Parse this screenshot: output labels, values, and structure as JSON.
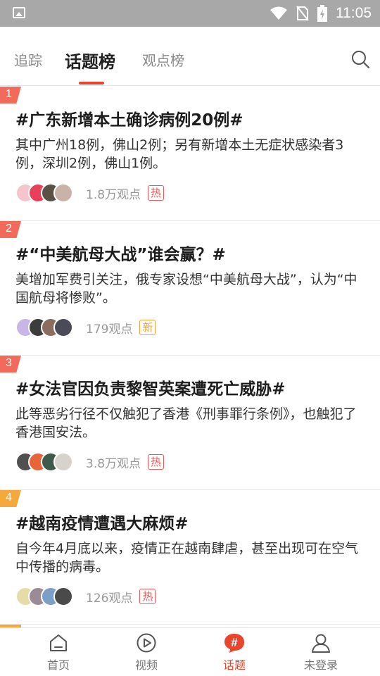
{
  "status_bar": {
    "time": "11:05"
  },
  "tabs": [
    {
      "label": "追踪"
    },
    {
      "label": "话题榜",
      "active": true
    },
    {
      "label": "观点榜"
    }
  ],
  "topics": [
    {
      "rank": "1",
      "rank_color": "#f26a5a",
      "title": "#广东新增本土确诊病例20例#",
      "desc": "其中广州18例，佛山2例；另有新增本土无症状感染者3例，深圳2例，佛山1例。",
      "views": "1.8万观点",
      "badge": "热",
      "avatar_colors": [
        "#f3c6cc",
        "#e8405a",
        "#5a5046",
        "#c9b3a8"
      ]
    },
    {
      "rank": "2",
      "rank_color": "#f26a5a",
      "title": "#“中美航母大战”谁会赢？#",
      "desc": "美增加军费引关注，俄专家设想“中美航母大战”，认为“中国航母将惨败”。",
      "views": "179观点",
      "badge": "新",
      "avatar_colors": [
        "#c8b6e6",
        "#3c3c3c",
        "#8a6d5e",
        "#4a4a58"
      ]
    },
    {
      "rank": "3",
      "rank_color": "#f26a5a",
      "title": "#女法官因负责黎智英案遭死亡威胁#",
      "desc": "此等恶劣行径不仅触犯了香港《刑事罪行条例》，也触犯了香港国安法。",
      "views": "3.8万观点",
      "badge": "热",
      "avatar_colors": [
        "#505050",
        "#e8653a",
        "#3f5a4a",
        "#d8d2cc"
      ]
    },
    {
      "rank": "4",
      "rank_color": "#f6a93b",
      "title": "#越南疫情遭遇大麻烦#",
      "desc": "自今年4月底以来，疫情正在越南肆虐，甚至出现可在空气中传播的病毒。",
      "views": "126观点",
      "badge": "热",
      "avatar_colors": [
        "#e6dcaa",
        "#9c8a96",
        "#7aa0c8",
        "#4a4a4a"
      ]
    }
  ],
  "bottom_nav": [
    {
      "label": "首页",
      "icon": "home-icon"
    },
    {
      "label": "视频",
      "icon": "play-circle-icon"
    },
    {
      "label": "话题",
      "icon": "hashtag-bubble-icon",
      "active": true
    },
    {
      "label": "未登录",
      "icon": "user-icon"
    }
  ],
  "colors": {
    "accent": "#e8452c",
    "hot": "#ef5a5a",
    "new": "#f5a23b",
    "rank_top": "#f26a5a",
    "rank_fourth": "#f6a93b"
  }
}
